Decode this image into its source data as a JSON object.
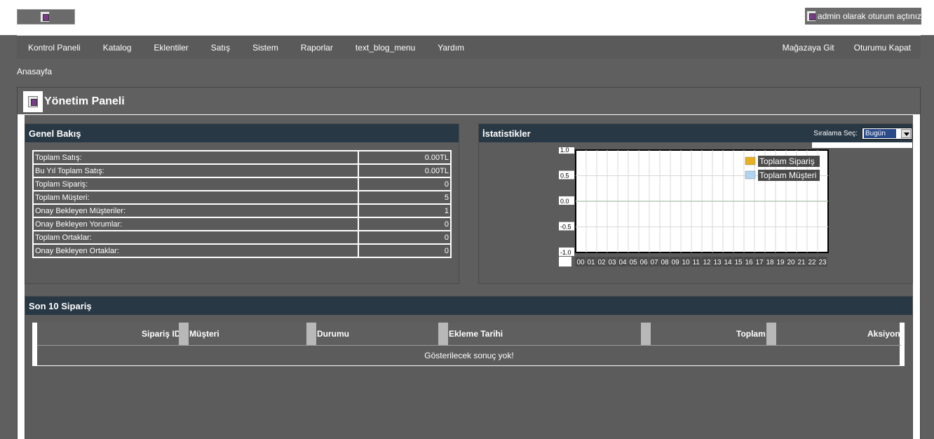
{
  "header": {
    "login_text": "admin olarak oturum açtınız"
  },
  "menu": {
    "left": [
      "Kontrol Paneli",
      "Katalog",
      "Eklentiler",
      "Satış",
      "Sistem",
      "Raporlar",
      "text_blog_menu",
      "Yardım"
    ],
    "right": [
      "Mağazaya Git",
      "Oturumu Kapat"
    ]
  },
  "breadcrumb": "Anasayfa",
  "page_title": "Yönetim Paneli",
  "overview": {
    "title": "Genel Bakış",
    "rows": [
      {
        "label": "Toplam Satış:",
        "value": "0.00TL"
      },
      {
        "label": "Bu Yıl Toplam Satış:",
        "value": "0.00TL"
      },
      {
        "label": "Toplam Sipariş:",
        "value": "0"
      },
      {
        "label": "Toplam Müşteri:",
        "value": "5"
      },
      {
        "label": "Onay Bekleyen Müşteriler:",
        "value": "1"
      },
      {
        "label": "Onay Bekleyen Yorumlar:",
        "value": "0"
      },
      {
        "label": "Toplam Ortaklar:",
        "value": "0"
      },
      {
        "label": "Onay Bekleyen Ortaklar:",
        "value": "0"
      }
    ]
  },
  "stats": {
    "title": "İstatistikler",
    "sort_label": "Sıralama Seç:",
    "sort_value": "Bugün"
  },
  "chart_data": {
    "type": "line",
    "x": [
      "00",
      "01",
      "02",
      "03",
      "04",
      "05",
      "06",
      "07",
      "08",
      "09",
      "10",
      "11",
      "12",
      "13",
      "14",
      "15",
      "16",
      "17",
      "18",
      "19",
      "20",
      "21",
      "22",
      "23"
    ],
    "y_ticks": [
      "1.0",
      "0.5",
      "0.0",
      "-0.5",
      "-1.0"
    ],
    "ylim": [
      -1.0,
      1.0
    ],
    "grid": true,
    "legend_position": "top-right",
    "series": [
      {
        "name": "Toplam Sipariş",
        "color": "#e8b020",
        "values": []
      },
      {
        "name": "Toplam Müşteri",
        "color": "#aed4f0",
        "values": []
      }
    ]
  },
  "orders": {
    "title": "Son 10 Sipariş",
    "columns": [
      "Sipariş ID",
      "Müşteri",
      "Durumu",
      "Ekleme Tarihi",
      "Toplam",
      "Aksiyon"
    ],
    "empty_text": "Gösterilecek sonuç yok!"
  }
}
